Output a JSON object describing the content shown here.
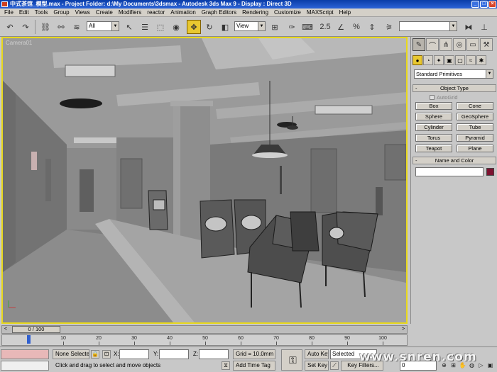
{
  "title_bar": {
    "title": "中式茶馆_模型.max    - Project Folder: d:\\My Documents\\3dsmax    - Autodesk 3ds Max 9    - Display : Direct 3D"
  },
  "menu": [
    "File",
    "Edit",
    "Tools",
    "Group",
    "Views",
    "Create",
    "Modifiers",
    "reactor",
    "Animation",
    "Graph Editors",
    "Rendering",
    "Customize",
    "MAXScript",
    "Help"
  ],
  "toolbar": {
    "selection_filter": "All",
    "reference_coord": "View",
    "named_selection": ""
  },
  "viewport": {
    "label": "Camera01"
  },
  "command_panel": {
    "category_dropdown": "Standard Primitives",
    "object_type_title": "Object Type",
    "autogrid_label": "AutoGrid",
    "object_buttons": [
      "Box",
      "Cone",
      "Sphere",
      "GeoSphere",
      "Cylinder",
      "Tube",
      "Torus",
      "Pyramid",
      "Teapot",
      "Plane"
    ],
    "name_color_title": "Name and Color",
    "rollout_collapse": "-",
    "object_color": "#7c1230"
  },
  "time": {
    "frame_display": "0 / 100",
    "ruler_labels": [
      "10",
      "20",
      "30",
      "40",
      "50",
      "60",
      "70",
      "80",
      "90",
      "100"
    ]
  },
  "status": {
    "selection_info": "None Selecte",
    "prompt": "Click and drag to select and move objects",
    "x_label": "X:",
    "y_label": "Y:",
    "z_label": "Z:",
    "grid": "Grid = 10.0mm",
    "add_time_tag": "Add Time Tag",
    "auto_key": "Auto Key",
    "set_key": "Set Key",
    "key_mode": "Selected",
    "key_filters": "Key Filters...",
    "frame_value": "0",
    "watermark": "www.snren.com"
  }
}
